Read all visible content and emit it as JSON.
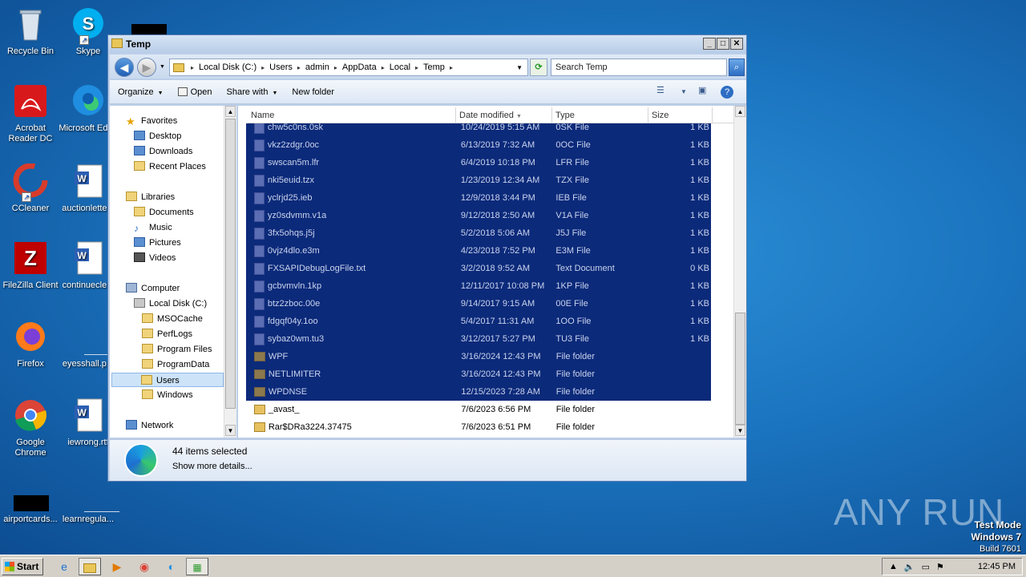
{
  "desktop": {
    "icons": [
      {
        "label": "Recycle Bin",
        "icon": "recycle-bin-icon"
      },
      {
        "label": "Skype",
        "icon": "skype-icon"
      },
      {
        "label": "Acrobat Reader DC",
        "icon": "acrobat-icon"
      },
      {
        "label": "Microsoft Edge",
        "icon": "edge-icon"
      },
      {
        "label": "CCleaner",
        "icon": "ccleaner-icon"
      },
      {
        "label": "auctionlette...",
        "icon": "word-doc-icon"
      },
      {
        "label": "FileZilla Client",
        "icon": "filezilla-icon"
      },
      {
        "label": "continuecle...",
        "icon": "word-doc-icon"
      },
      {
        "label": "Firefox",
        "icon": "firefox-icon"
      },
      {
        "label": "eyesshall.p...",
        "icon": "file-icon"
      },
      {
        "label": "Google Chrome",
        "icon": "chrome-icon"
      },
      {
        "label": "iewrong.rtf",
        "icon": "word-doc-icon"
      },
      {
        "label": "airportcards...",
        "icon": "black-file-icon"
      },
      {
        "label": "learnregula...",
        "icon": "file-icon"
      }
    ],
    "watermark": "ANY RUN",
    "test_mode": {
      "line1": "Test Mode",
      "line2": "Windows 7",
      "line3": "Build 7601"
    }
  },
  "window": {
    "title": "Temp",
    "buttons": {
      "minimize": "_",
      "maximize": "□",
      "close": "✕"
    },
    "breadcrumb": [
      "Local Disk (C:)",
      "Users",
      "admin",
      "AppData",
      "Local",
      "Temp"
    ],
    "search_placeholder": "Search Temp",
    "toolbar": {
      "organize": "Organize",
      "open": "Open",
      "share_with": "Share with",
      "new_folder": "New folder"
    },
    "nav": {
      "favorites": "Favorites",
      "desktop": "Desktop",
      "downloads": "Downloads",
      "recent": "Recent Places",
      "libraries": "Libraries",
      "documents": "Documents",
      "music": "Music",
      "pictures": "Pictures",
      "videos": "Videos",
      "computer": "Computer",
      "local_disk": "Local Disk (C:)",
      "msocache": "MSOCache",
      "perflogs": "PerfLogs",
      "program_files": "Program Files",
      "programdata": "ProgramData",
      "users": "Users",
      "windows": "Windows",
      "network": "Network"
    },
    "columns": {
      "name": "Name",
      "date": "Date modified",
      "type": "Type",
      "size": "Size"
    },
    "files": [
      {
        "name": "chw5c0ns.0sk",
        "date": "10/24/2019 5:15 AM",
        "type": "0SK File",
        "size": "1 KB",
        "sel": true,
        "folder": false
      },
      {
        "name": "vkz2zdgr.0oc",
        "date": "6/13/2019 7:32 AM",
        "type": "0OC File",
        "size": "1 KB",
        "sel": true,
        "folder": false
      },
      {
        "name": "swscan5m.lfr",
        "date": "6/4/2019 10:18 PM",
        "type": "LFR File",
        "size": "1 KB",
        "sel": true,
        "folder": false
      },
      {
        "name": "nki5euid.tzx",
        "date": "1/23/2019 12:34 AM",
        "type": "TZX File",
        "size": "1 KB",
        "sel": true,
        "folder": false
      },
      {
        "name": "yclrjd25.ieb",
        "date": "12/9/2018 3:44 PM",
        "type": "IEB File",
        "size": "1 KB",
        "sel": true,
        "folder": false
      },
      {
        "name": "yz0sdvmm.v1a",
        "date": "9/12/2018 2:50 AM",
        "type": "V1A File",
        "size": "1 KB",
        "sel": true,
        "folder": false
      },
      {
        "name": "3fx5ohqs.j5j",
        "date": "5/2/2018 5:06 AM",
        "type": "J5J File",
        "size": "1 KB",
        "sel": true,
        "folder": false
      },
      {
        "name": "0vjz4dlo.e3m",
        "date": "4/23/2018 7:52 PM",
        "type": "E3M File",
        "size": "1 KB",
        "sel": true,
        "folder": false
      },
      {
        "name": "FXSAPIDebugLogFile.txt",
        "date": "3/2/2018 9:52 AM",
        "type": "Text Document",
        "size": "0 KB",
        "sel": true,
        "folder": false
      },
      {
        "name": "gcbvmvln.1kp",
        "date": "12/11/2017 10:08 PM",
        "type": "1KP File",
        "size": "1 KB",
        "sel": true,
        "folder": false
      },
      {
        "name": "btz2zboc.00e",
        "date": "9/14/2017 9:15 AM",
        "type": "00E File",
        "size": "1 KB",
        "sel": true,
        "folder": false
      },
      {
        "name": "fdgqf04y.1oo",
        "date": "5/4/2017 11:31 AM",
        "type": "1OO File",
        "size": "1 KB",
        "sel": true,
        "folder": false
      },
      {
        "name": "sybaz0wm.tu3",
        "date": "3/12/2017 5:27 PM",
        "type": "TU3 File",
        "size": "1 KB",
        "sel": true,
        "folder": false
      },
      {
        "name": "WPF",
        "date": "3/16/2024 12:43 PM",
        "type": "File folder",
        "size": "",
        "sel": true,
        "folder": true
      },
      {
        "name": "NETLIMITER",
        "date": "3/16/2024 12:43 PM",
        "type": "File folder",
        "size": "",
        "sel": true,
        "folder": true
      },
      {
        "name": "WPDNSE",
        "date": "12/15/2023 7:28 AM",
        "type": "File folder",
        "size": "",
        "sel": true,
        "folder": true
      },
      {
        "name": "_avast_",
        "date": "7/6/2023 6:56 PM",
        "type": "File folder",
        "size": "",
        "sel": false,
        "folder": true
      },
      {
        "name": "Rar$DRa3224.37475",
        "date": "7/6/2023 6:51 PM",
        "type": "File folder",
        "size": "",
        "sel": false,
        "folder": true
      }
    ],
    "details": {
      "count": "44 items selected",
      "more": "Show more details..."
    }
  },
  "taskbar": {
    "start": "Start",
    "clock": "12:45 PM"
  },
  "colors": {
    "selection": "#0c2a7a",
    "window_frame": "#bccfe9",
    "desktop": "#1b74bf"
  }
}
